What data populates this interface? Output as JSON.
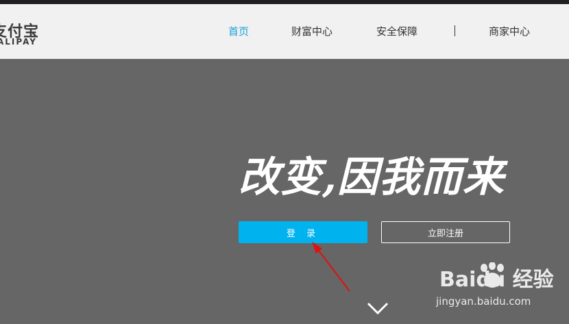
{
  "logo": {
    "cn": "支付宝",
    "en": "ALIPAY"
  },
  "nav": {
    "items": [
      {
        "label": "首页",
        "active": true
      },
      {
        "label": "财富中心",
        "active": false
      },
      {
        "label": "安全保障",
        "active": false
      },
      {
        "label": "商家中心",
        "active": false
      }
    ]
  },
  "hero": {
    "slogan": "改变,因我而来",
    "login_label": "登 录",
    "register_label": "立即注册"
  },
  "watermark": {
    "brand": "Baidu 经验",
    "url": "jingyan.baidu.com"
  },
  "colors": {
    "accent": "#1a9fd8",
    "login_button": "#00b2ee",
    "hero_bg": "#666666",
    "header_bg": "#f1f1f1",
    "annotation_arrow": "#e01010"
  },
  "icons": {
    "scroll": "chevron-down-icon",
    "annotation": "red-arrow-icon"
  }
}
